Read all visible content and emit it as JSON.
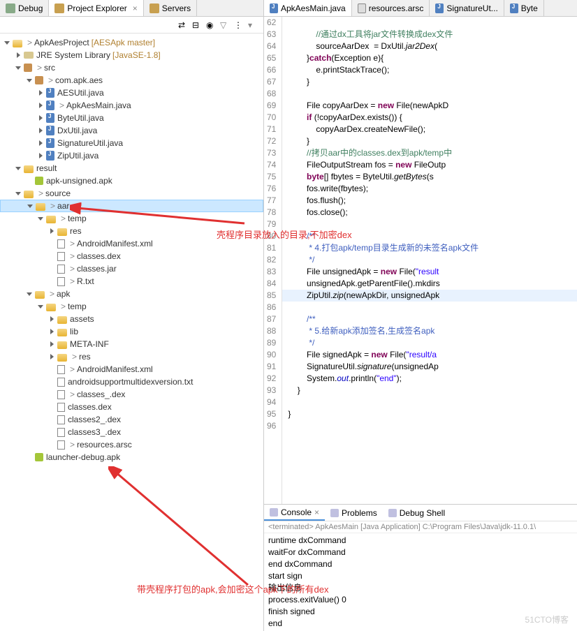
{
  "leftTabs": [
    {
      "label": "Debug",
      "icon": "debug"
    },
    {
      "label": "Project Explorer",
      "icon": "project",
      "active": true,
      "close": true
    },
    {
      "label": "Servers",
      "icon": "servers"
    }
  ],
  "toolbarIcons": [
    "link",
    "collapse",
    "filter",
    "menu"
  ],
  "tree": [
    {
      "depth": 0,
      "exp": "open",
      "icon": "project",
      "gt": true,
      "label": "ApkAesProject",
      "suffix": "[AESApk master]"
    },
    {
      "depth": 1,
      "exp": "closed",
      "icon": "lib",
      "label": "JRE System Library",
      "suffix": "[JavaSE-1.8]"
    },
    {
      "depth": 1,
      "exp": "open",
      "icon": "src",
      "gt": true,
      "label": "src"
    },
    {
      "depth": 2,
      "exp": "open",
      "icon": "package",
      "gt": true,
      "label": "com.apk.aes"
    },
    {
      "depth": 3,
      "exp": "closed",
      "icon": "java",
      "label": "AESUtil.java"
    },
    {
      "depth": 3,
      "exp": "closed",
      "icon": "java",
      "gt": true,
      "label": "ApkAesMain.java"
    },
    {
      "depth": 3,
      "exp": "closed",
      "icon": "java",
      "label": "ByteUtil.java"
    },
    {
      "depth": 3,
      "exp": "closed",
      "icon": "java",
      "label": "DxUtil.java"
    },
    {
      "depth": 3,
      "exp": "closed",
      "icon": "java",
      "label": "SignatureUtil.java"
    },
    {
      "depth": 3,
      "exp": "closed",
      "icon": "java",
      "label": "ZipUtil.java"
    },
    {
      "depth": 1,
      "exp": "open",
      "icon": "folder",
      "label": "result"
    },
    {
      "depth": 2,
      "exp": "none",
      "icon": "android",
      "label": "apk-unsigned.apk"
    },
    {
      "depth": 1,
      "exp": "open",
      "icon": "folder",
      "gt": true,
      "label": "source"
    },
    {
      "depth": 2,
      "exp": "open",
      "icon": "folder",
      "gt": true,
      "label": "aar",
      "selected": true
    },
    {
      "depth": 3,
      "exp": "open",
      "icon": "folder",
      "gt": true,
      "label": "temp"
    },
    {
      "depth": 4,
      "exp": "closed",
      "icon": "folder",
      "label": "res"
    },
    {
      "depth": 4,
      "exp": "none",
      "icon": "file",
      "gt": true,
      "label": "AndroidManifest.xml"
    },
    {
      "depth": 4,
      "exp": "none",
      "icon": "file",
      "gt": true,
      "label": "classes.dex"
    },
    {
      "depth": 4,
      "exp": "none",
      "icon": "file",
      "gt": true,
      "label": "classes.jar"
    },
    {
      "depth": 4,
      "exp": "none",
      "icon": "file",
      "gt": true,
      "label": "R.txt"
    },
    {
      "depth": 2,
      "exp": "open",
      "icon": "folder",
      "gt": true,
      "label": "apk"
    },
    {
      "depth": 3,
      "exp": "open",
      "icon": "folder",
      "gt": true,
      "label": "temp"
    },
    {
      "depth": 4,
      "exp": "closed",
      "icon": "folder",
      "label": "assets"
    },
    {
      "depth": 4,
      "exp": "closed",
      "icon": "folder",
      "label": "lib"
    },
    {
      "depth": 4,
      "exp": "closed",
      "icon": "folder",
      "label": "META-INF"
    },
    {
      "depth": 4,
      "exp": "closed",
      "icon": "folder",
      "gt": true,
      "label": "res"
    },
    {
      "depth": 4,
      "exp": "none",
      "icon": "file",
      "gt": true,
      "label": "AndroidManifest.xml"
    },
    {
      "depth": 4,
      "exp": "none",
      "icon": "file",
      "label": "androidsupportmultidexversion.txt"
    },
    {
      "depth": 4,
      "exp": "none",
      "icon": "file",
      "gt": true,
      "label": "classes_.dex"
    },
    {
      "depth": 4,
      "exp": "none",
      "icon": "file",
      "label": "classes.dex"
    },
    {
      "depth": 4,
      "exp": "none",
      "icon": "file",
      "label": "classes2_.dex"
    },
    {
      "depth": 4,
      "exp": "none",
      "icon": "file",
      "label": "classes3_.dex"
    },
    {
      "depth": 4,
      "exp": "none",
      "icon": "file",
      "gt": true,
      "label": "resources.arsc"
    },
    {
      "depth": 2,
      "exp": "none",
      "icon": "android",
      "label": "launcher-debug.apk"
    }
  ],
  "annotations": {
    "a1": "壳程序目录放入的目录,不加密dex",
    "a2": "带壳程序打包的apk,会加密这个apk下的所有dex"
  },
  "editorTabs": [
    {
      "label": "ApkAesMain.java",
      "icon": "java",
      "active": true
    },
    {
      "label": "resources.arsc",
      "icon": "file"
    },
    {
      "label": "SignatureUt...",
      "icon": "java"
    },
    {
      "label": "Byte",
      "icon": "java"
    }
  ],
  "code": {
    "start": 62,
    "lines": [
      {
        "n": 62,
        "html": ""
      },
      {
        "n": 63,
        "html": "            <span class='cmt'>//通过dx工具将jar文件转换成dex文件</span>"
      },
      {
        "n": 64,
        "html": "            sourceAarDex  = DxUtil.<span class='method-italic'>jar2Dex</span>("
      },
      {
        "n": 65,
        "html": "        }<span class='kw'>catch</span>(Exception e){"
      },
      {
        "n": 66,
        "html": "            e.printStackTrace();"
      },
      {
        "n": 67,
        "html": "        }"
      },
      {
        "n": 68,
        "html": ""
      },
      {
        "n": 69,
        "html": "        File copyAarDex = <span class='kw'>new</span> File(newApkD"
      },
      {
        "n": 70,
        "html": "        <span class='kw'>if</span> (!copyAarDex.exists()) {"
      },
      {
        "n": 71,
        "html": "            copyAarDex.createNewFile();"
      },
      {
        "n": 72,
        "html": "        }"
      },
      {
        "n": 73,
        "html": "        <span class='cmt'>//拷贝aar中的classes.dex到apk/temp中</span>"
      },
      {
        "n": 74,
        "html": "        FileOutputStream fos = <span class='kw'>new</span> FileOutp"
      },
      {
        "n": 75,
        "html": "        <span class='kw'>byte</span>[] fbytes = ByteUtil.<span class='method-italic'>getBytes</span>(s"
      },
      {
        "n": 76,
        "html": "        fos.write(fbytes);"
      },
      {
        "n": 77,
        "html": "        fos.flush();"
      },
      {
        "n": 78,
        "html": "        fos.close();"
      },
      {
        "n": 79,
        "html": ""
      },
      {
        "n": 80,
        "html": "        <span class='jdoc'>/**</span>"
      },
      {
        "n": 81,
        "html": "<span class='jdoc'>         * 4.打包apk/temp目录生成新的未签名apk文件</span>"
      },
      {
        "n": 82,
        "html": "<span class='jdoc'>         */</span>"
      },
      {
        "n": 83,
        "html": "        File unsignedApk = <span class='kw'>new</span> File(<span class='str'>\"result</span>"
      },
      {
        "n": 84,
        "html": "        unsignedApk.getParentFile().mkdirs"
      },
      {
        "n": 85,
        "hl": true,
        "html": "        ZipUtil.<span class='method-italic'>zip</span>(newApkDir, unsignedApk"
      },
      {
        "n": 86,
        "html": ""
      },
      {
        "n": 87,
        "html": "        <span class='jdoc'>/**</span>"
      },
      {
        "n": 88,
        "html": "<span class='jdoc'>         * 5.给新apk添加签名,生成签名apk</span>"
      },
      {
        "n": 89,
        "html": "<span class='jdoc'>         */</span>"
      },
      {
        "n": 90,
        "html": "        File signedApk = <span class='kw'>new</span> File(<span class='str'>\"result/a</span>"
      },
      {
        "n": 91,
        "html": "        SignatureUtil.<span class='method-italic'>signature</span>(unsignedAp"
      },
      {
        "n": 92,
        "html": "        System.<span class='static-blue'>out</span>.println(<span class='str'>\"end\"</span>);"
      },
      {
        "n": 93,
        "html": "    }"
      },
      {
        "n": 94,
        "html": ""
      },
      {
        "n": 95,
        "html": "}"
      },
      {
        "n": 96,
        "html": ""
      }
    ]
  },
  "bottomTabs": [
    {
      "label": "Console",
      "active": true,
      "close": true
    },
    {
      "label": "Problems"
    },
    {
      "label": "Debug Shell"
    }
  ],
  "console": {
    "header": "<terminated> ApkAesMain [Java Application] C:\\Program Files\\Java\\jdk-11.0.1\\",
    "lines": [
      "runtime  dxCommand",
      "waitFor  dxCommand",
      "end  dxCommand",
      "start sign",
      "输出信息",
      "process.exitValue() 0",
      "finish signed",
      "end"
    ]
  },
  "watermark": "51CTO博客"
}
